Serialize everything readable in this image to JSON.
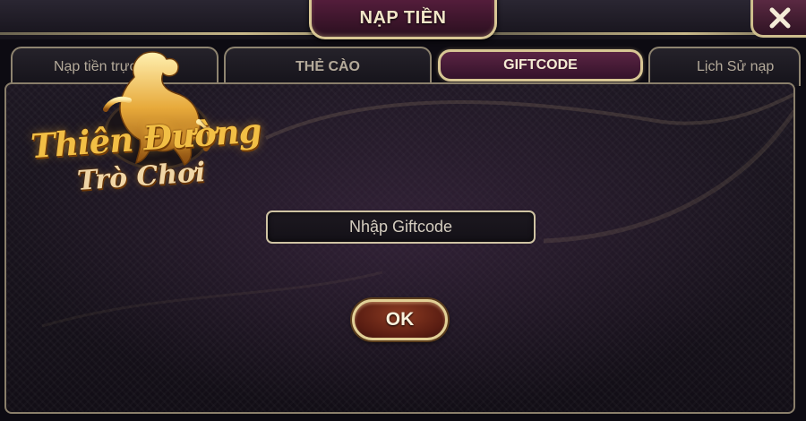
{
  "window": {
    "title": "NẠP TIỀN",
    "close_label": "close"
  },
  "tabs": [
    {
      "label": "Nạp tiền trực tuyến",
      "active": false
    },
    {
      "label": "THẺ CÀO",
      "active": false
    },
    {
      "label": "GIFTCODE",
      "active": true
    },
    {
      "label": "Lịch Sử nạp",
      "active": false
    }
  ],
  "logo": {
    "line1": "Thiên Đường",
    "line2": "Trò Chơi"
  },
  "giftcode": {
    "placeholder": "Nhập Giftcode",
    "value": ""
  },
  "actions": {
    "ok_label": "OK"
  },
  "colors": {
    "accent_gold": "#d8c694",
    "active_tab": "#5a2443",
    "ok_button": "#8c3b22",
    "background": "#120e16"
  }
}
